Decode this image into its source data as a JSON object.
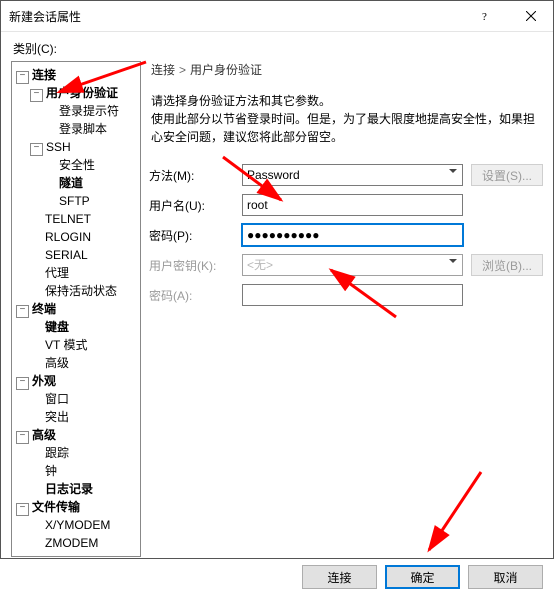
{
  "window": {
    "title": "新建会话属性"
  },
  "category_label": "类别(C):",
  "tree": {
    "connection": "连接",
    "auth": "用户身份验证",
    "login_prompt": "登录提示符",
    "login_script": "登录脚本",
    "ssh": "SSH",
    "security": "安全性",
    "tunnel": "隧道",
    "sftp": "SFTP",
    "telnet": "TELNET",
    "rlogin": "RLOGIN",
    "serial": "SERIAL",
    "proxy": "代理",
    "keepalive": "保持活动状态",
    "terminal": "终端",
    "keyboard": "键盘",
    "vtmode": "VT 模式",
    "advanced_term": "高级",
    "appearance": "外观",
    "window_node": "窗口",
    "highlight": "突出",
    "advanced": "高级",
    "trace": "跟踪",
    "bell": "钟",
    "logging": "日志记录",
    "filetransfer": "文件传输",
    "xymodem": "X/YMODEM",
    "zmodem": "ZMODEM"
  },
  "breadcrumb": {
    "a": "连接",
    "b": "用户身份验证"
  },
  "desc": {
    "l1": "请选择身份验证方法和其它参数。",
    "l2": "使用此部分以节省登录时间。但是，为了最大限度地提高安全性，如果担心安全问题，建议您将此部分留空。"
  },
  "form": {
    "method_label": "方法(M):",
    "method_value": "Password",
    "setup_btn": "设置(S)...",
    "user_label": "用户名(U):",
    "user_value": "root",
    "pass_label": "密码(P):",
    "pass_value": "●●●●●●●●●●",
    "userkey_label": "用户密钥(K):",
    "userkey_value": "<无>",
    "browse_btn": "浏览(B)...",
    "passphrase_label": "密码(A):"
  },
  "footer": {
    "connect": "连接",
    "ok": "确定",
    "cancel": "取消"
  }
}
